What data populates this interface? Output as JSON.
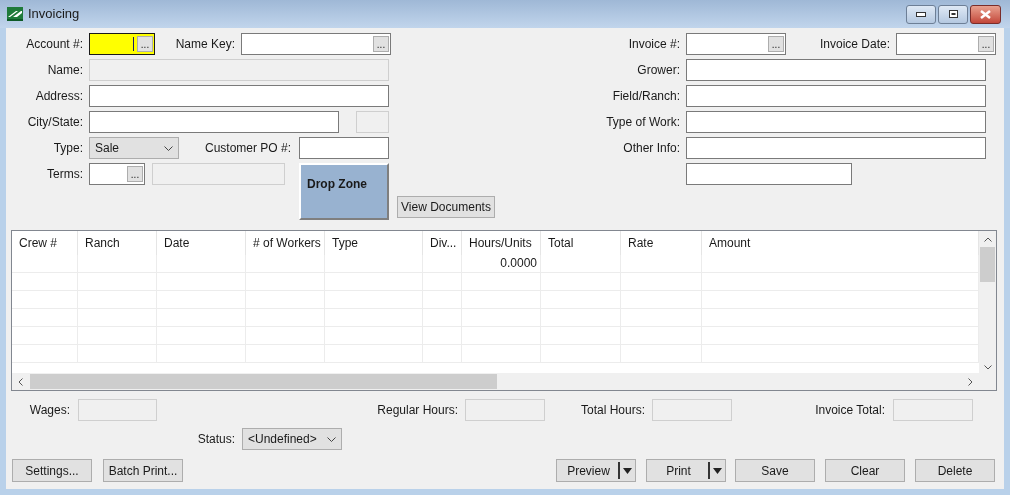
{
  "window": {
    "title": "Invoicing"
  },
  "form": {
    "account": {
      "label": "Account #:",
      "browse": "...",
      "focused": true
    },
    "name_key": {
      "label": "Name Key:",
      "browse": "..."
    },
    "name": {
      "label": "Name:",
      "disabled": true
    },
    "address": {
      "label": "Address:",
      "disabled": false
    },
    "city_state": {
      "label": "City/State:",
      "disabled": false
    },
    "city_state_extra": {
      "disabled": true
    },
    "type": {
      "label": "Type:",
      "value": "Sale"
    },
    "customer_po": {
      "label": "Customer PO #:",
      "disabled": false
    },
    "terms": {
      "label": "Terms:",
      "browse": "..."
    },
    "terms_description": {
      "disabled": true
    },
    "drop_zone": {
      "label": "Drop Zone"
    },
    "view_documents": "View Documents",
    "invoice_no": {
      "label": "Invoice #:",
      "browse": "..."
    },
    "invoice_date": {
      "label": "Invoice Date:",
      "browse": "..."
    },
    "grower": {
      "label": "Grower:",
      "disabled": false
    },
    "field_ranch": {
      "label": "Field/Ranch:",
      "disabled": false
    },
    "type_of_work": {
      "label": "Type of Work:",
      "disabled": false
    },
    "other_info": {
      "label": "Other Info:",
      "disabled": false
    },
    "other_info_2": {
      "disabled": false
    }
  },
  "table": {
    "columns": [
      "Crew #",
      "Ranch",
      "Date",
      "# of Workers",
      "Type",
      "Div...",
      "Hours/Units",
      "Total",
      "Rate",
      "Amount"
    ],
    "rows": [
      {
        "hours_units": "0.0000"
      }
    ]
  },
  "totals": {
    "wages": {
      "label": "Wages:",
      "disabled": true
    },
    "regular_hours": {
      "label": "Regular Hours:",
      "disabled": true
    },
    "total_hours": {
      "label": "Total Hours:",
      "disabled": true
    },
    "invoice_total": {
      "label": "Invoice Total:",
      "disabled": true
    },
    "status": {
      "label": "Status:",
      "value": "<Undefined>"
    }
  },
  "buttons": [
    {
      "label": "Settings...",
      "kind": "plain"
    },
    {
      "label": "Batch Print...",
      "kind": "plain"
    },
    {
      "label": "Preview",
      "kind": "split"
    },
    {
      "label": "Print",
      "kind": "split"
    },
    {
      "label": "Save",
      "kind": "plain"
    },
    {
      "label": "Clear",
      "kind": "plain"
    },
    {
      "label": "Delete",
      "kind": "plain"
    }
  ]
}
